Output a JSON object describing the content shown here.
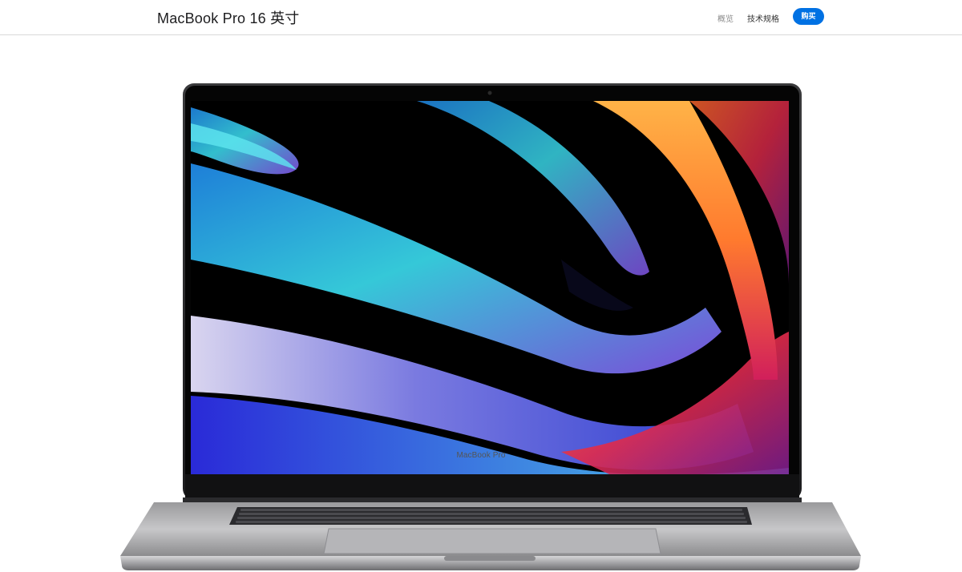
{
  "header": {
    "title": "MacBook Pro 16 英寸",
    "links": [
      {
        "label": "概览",
        "current": true
      },
      {
        "label": "技术规格",
        "current": false
      }
    ],
    "buy_label": "购买",
    "accent_color": "#0071e3"
  },
  "hero": {
    "device_label": "MacBook Pro",
    "image_description_icon": "laptop-illustration"
  }
}
